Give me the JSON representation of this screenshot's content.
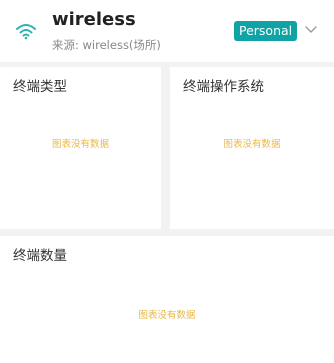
{
  "header": {
    "icon": "wifi-icon",
    "title": "wireless",
    "subtitle": "来源: wireless(场所)",
    "badge": "Personal",
    "dropdown_icon": "chevron-down-icon",
    "colors": {
      "accent": "#0fa3a6",
      "icon": "#2bb3b6"
    }
  },
  "cards": [
    {
      "title": "终端类型",
      "empty_text": "图表没有数据"
    },
    {
      "title": "终端操作系统",
      "empty_text": "图表没有数据"
    },
    {
      "title": "终端数量",
      "empty_text": "图表没有数据"
    }
  ],
  "colors": {
    "empty_text": "#e8b84a",
    "background": "#f2f2f2"
  }
}
